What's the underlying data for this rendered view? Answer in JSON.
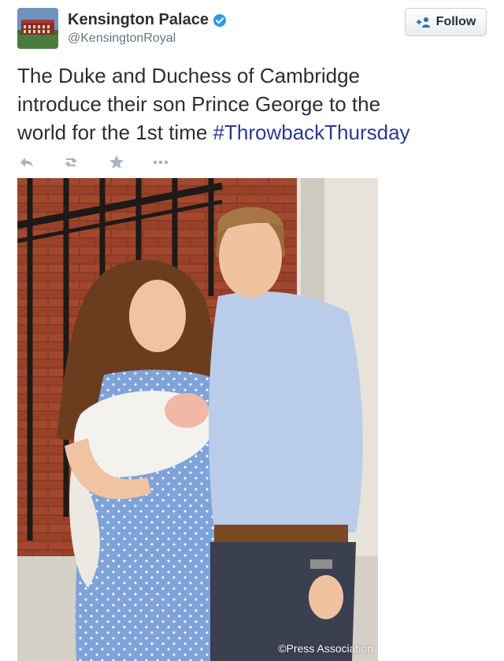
{
  "account": {
    "name": "Kensington Palace",
    "handle": "@KensingtonRoyal",
    "verified": true,
    "avatar_icon": "palace-avatar"
  },
  "follow_button": {
    "label": "Follow",
    "icon": "add-user-icon"
  },
  "tweet": {
    "line1": "The Duke and Duchess of Cambridge",
    "line2": "introduce their son Prince George to the",
    "line3_text": "world for the 1st time ",
    "hashtag": "#ThrowbackThursday"
  },
  "actions": [
    {
      "name": "reply-icon"
    },
    {
      "name": "retweet-icon"
    },
    {
      "name": "favorite-icon"
    },
    {
      "name": "more-icon"
    }
  ],
  "photo": {
    "credit": "©Press Association"
  },
  "colors": {
    "hashtag": "#2b3a8f",
    "action_icon": "#a8b4bf",
    "verified": "#2f9ae0"
  }
}
